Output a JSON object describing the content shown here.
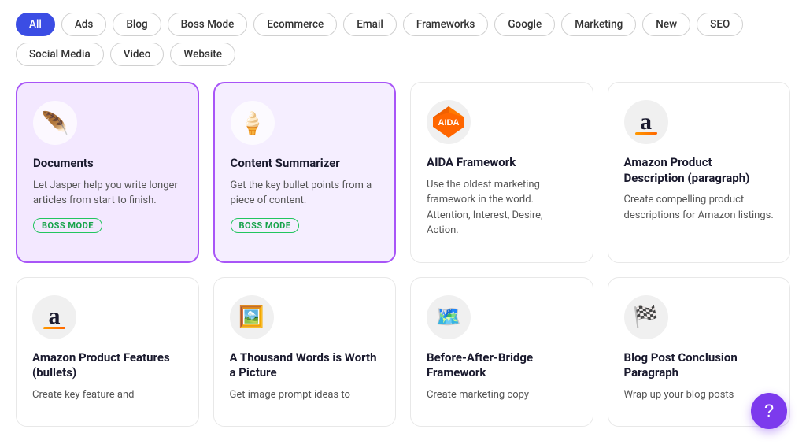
{
  "filters": [
    {
      "label": "All",
      "active": true
    },
    {
      "label": "Ads",
      "active": false
    },
    {
      "label": "Blog",
      "active": false
    },
    {
      "label": "Boss Mode",
      "active": false
    },
    {
      "label": "Ecommerce",
      "active": false
    },
    {
      "label": "Email",
      "active": false
    },
    {
      "label": "Frameworks",
      "active": false
    },
    {
      "label": "Google",
      "active": false
    },
    {
      "label": "Marketing",
      "active": false
    },
    {
      "label": "New",
      "active": false
    },
    {
      "label": "SEO",
      "active": false
    },
    {
      "label": "Social Media",
      "active": false
    },
    {
      "label": "Video",
      "active": false
    },
    {
      "label": "Website",
      "active": false
    }
  ],
  "cards": [
    {
      "title": "Documents",
      "desc": "Let Jasper help you write longer articles from start to finish.",
      "badge": "BOSS MODE",
      "icon_type": "document",
      "style": "purple-selected"
    },
    {
      "title": "Content Summarizer",
      "desc": "Get the key bullet points from a piece of content.",
      "badge": "BOSS MODE",
      "icon_type": "icecream",
      "style": "purple-light"
    },
    {
      "title": "AIDA Framework",
      "desc": "Use the oldest marketing framework in the world. Attention, Interest, Desire, Action.",
      "badge": "",
      "icon_type": "aida",
      "style": "normal"
    },
    {
      "title": "Amazon Product Description (paragraph)",
      "desc": "Create compelling product descriptions for Amazon listings.",
      "badge": "",
      "icon_type": "amazon",
      "style": "normal"
    },
    {
      "title": "Amazon Product Features (bullets)",
      "desc": "Create key feature and",
      "badge": "",
      "icon_type": "amazon2",
      "style": "normal"
    },
    {
      "title": "A Thousand Words is Worth a Picture",
      "desc": "Get image prompt ideas to",
      "badge": "",
      "icon_type": "picture",
      "style": "normal"
    },
    {
      "title": "Before-After-Bridge Framework",
      "desc": "Create marketing copy",
      "badge": "",
      "icon_type": "bridge",
      "style": "normal"
    },
    {
      "title": "Blog Post Conclusion Paragraph",
      "desc": "Wrap up your blog posts",
      "badge": "",
      "icon_type": "flag",
      "style": "normal"
    }
  ],
  "fab": {
    "label": "?"
  }
}
